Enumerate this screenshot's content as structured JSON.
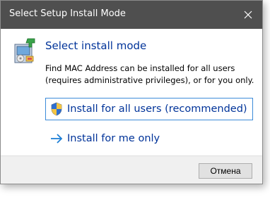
{
  "window": {
    "title": "Select Setup Install Mode"
  },
  "content": {
    "heading": "Select install mode",
    "description": "Find MAC Address can be installed for all users (requires administrative privileges), or for you only.",
    "options": [
      {
        "label": "Install for all users (recommended)",
        "icon": "uac-shield-icon"
      },
      {
        "label": "Install for me only",
        "icon": "arrow-right-icon"
      }
    ]
  },
  "footer": {
    "cancel_label": "Отмена"
  },
  "colors": {
    "titlebar": "#4f4f4f",
    "link": "#003399",
    "focus_border": "#3c8bd9",
    "footer_bg": "#f0f0f0"
  }
}
